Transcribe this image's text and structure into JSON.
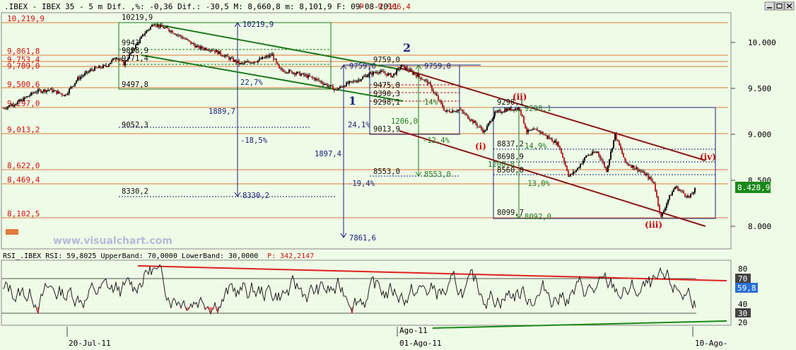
{
  "header": {
    "price_title": ".IBEX - IBEX 35 -  5 m Dif. ,%: -0,36 Dif.: -30,5 M: 8,660,8 m: 8,101,9 F: 09-08-2011",
    "price_p_label": "P : 9,966,4",
    "rsi_title": "RSI_.IBEX RSI: 59,8025 UpperBand: 70,0000 LowerBand: 30,0000",
    "rsi_p_label": "P: 342,2147"
  },
  "watermark": "www.visualchart.com",
  "colors": {
    "bg": "#eefbe6",
    "level_line": "#e07a3c",
    "upper_channel": "#8b1a1a",
    "green_channel": "#1f7a1f",
    "blue_annot": "#1a237e",
    "candle_up": "#111111",
    "candle_down": "#cc2222",
    "rsi_line": "#222222",
    "rsi_hi_line": "#e02020",
    "rsi_low_line": "#1a8a1a"
  },
  "price_axis": {
    "ticks": [
      "10.000",
      "9.500",
      "9.000",
      "8.500",
      "8.000"
    ],
    "tick_values": [
      10000,
      9500,
      9000,
      8500,
      8000
    ],
    "current_price_tag": "8.428,9",
    "ylim": [
      7760,
      10340
    ]
  },
  "rsi_axis": {
    "ticks": [
      "80",
      "60",
      "40",
      "20"
    ],
    "tick_values": [
      80,
      60,
      40,
      20
    ],
    "upper_tag": "70",
    "current_tag": "59,8",
    "lower_tag": "30",
    "ylim": [
      10,
      88
    ]
  },
  "x_axis": {
    "labels": [
      "20-Jul-11",
      "Ago-11",
      "01-Ago-11",
      "10-Ago-"
    ]
  },
  "left_levels": [
    "10,219,9",
    "9,861,8",
    "9,753,4",
    "9,709,0",
    "9,500,6",
    "9,297,0",
    "9,013,2",
    "8,622,0",
    "8,469,4",
    "8,102,5"
  ],
  "wave_labels": {
    "w1": "1",
    "w2": "2",
    "wi": "(i)",
    "wii": "(ii)",
    "wiii": "(iii)",
    "wiv": "(iv)"
  },
  "annotations": {
    "a1": "10219,9",
    "a2": "10219,9",
    "a3": "9943",
    "a4": "9858,9",
    "a5": "9771,4",
    "a6": "9497,8",
    "a7": "22,7%",
    "a8": "1889,7",
    "a9": "-18,5%",
    "a10": "9052,3",
    "a11": "8330,2",
    "a12": "8330,2",
    "a13": "1897,4",
    "a14": "7861,6",
    "a15": "9759,0",
    "a16": "9759,0",
    "a17": "9759,0",
    "a18": "9475,8",
    "a19": "9390,3",
    "a20": "9298,1",
    "a21": "14%",
    "a22": "24,1%",
    "a23": "1206,0",
    "a24": "9013,9",
    "a25": "-12,4%",
    "a26": "-19,4%",
    "a27": "8553,0",
    "a28": "8553,0",
    "a29": "9298,1",
    "a30": "9298,1",
    "a31": "8837,2",
    "a32": "14,9%",
    "a33": "8698,9",
    "a34": "1200,8",
    "a35": "8560,8",
    "a36": "-13,0%",
    "a37": "8099,7",
    "a38": "8092,0"
  },
  "chart_data": [
    {
      "type": "candlestick",
      "title": ".IBEX - IBEX 35 - 5 m",
      "x": [
        "20-Jul-11",
        "Ago-11",
        "01-Ago-11",
        "10-Ago-"
      ],
      "ylim": [
        7760,
        10340
      ],
      "close_path": [
        [
          5,
          9297
        ],
        [
          30,
          9380
        ],
        [
          50,
          9480
        ],
        [
          70,
          9500
        ],
        [
          92,
          9440
        ],
        [
          110,
          9620
        ],
        [
          130,
          9720
        ],
        [
          150,
          9760
        ],
        [
          165,
          9860
        ],
        [
          175,
          9780
        ],
        [
          190,
          9960
        ],
        [
          205,
          10120
        ],
        [
          217,
          10219
        ],
        [
          240,
          10150
        ],
        [
          260,
          10060
        ],
        [
          280,
          9960
        ],
        [
          300,
          9940
        ],
        [
          320,
          9860
        ],
        [
          340,
          9780
        ],
        [
          365,
          9820
        ],
        [
          385,
          9880
        ],
        [
          395,
          9720
        ],
        [
          420,
          9680
        ],
        [
          445,
          9620
        ],
        [
          465,
          9540
        ],
        [
          475,
          9497
        ],
        [
          490,
          9560
        ],
        [
          505,
          9600
        ],
        [
          520,
          9660
        ],
        [
          535,
          9700
        ],
        [
          555,
          9650
        ],
        [
          568,
          9759
        ],
        [
          585,
          9680
        ],
        [
          605,
          9580
        ],
        [
          618,
          9420
        ],
        [
          630,
          9260
        ],
        [
          650,
          9280
        ],
        [
          665,
          9180
        ],
        [
          685,
          9040
        ],
        [
          700,
          9240
        ],
        [
          715,
          9280
        ],
        [
          735,
          9298
        ],
        [
          745,
          9040
        ],
        [
          760,
          9060
        ],
        [
          775,
          8980
        ],
        [
          790,
          8900
        ],
        [
          805,
          8553
        ],
        [
          815,
          8620
        ],
        [
          830,
          8780
        ],
        [
          845,
          8820
        ],
        [
          858,
          8620
        ],
        [
          870,
          9010
        ],
        [
          885,
          8700
        ],
        [
          900,
          8640
        ],
        [
          915,
          8560
        ],
        [
          925,
          8480
        ],
        [
          935,
          8101
        ],
        [
          945,
          8300
        ],
        [
          955,
          8440
        ],
        [
          965,
          8380
        ],
        [
          975,
          8320
        ],
        [
          985,
          8429
        ]
      ]
    },
    {
      "type": "line",
      "title": "RSI_.IBEX RSI",
      "ylim": [
        10,
        88
      ],
      "series": [
        {
          "name": "RSI",
          "values": []
        }
      ],
      "bands": {
        "upper": 70,
        "lower": 30
      },
      "current": 59.8
    }
  ]
}
